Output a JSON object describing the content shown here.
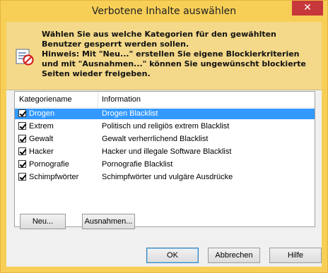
{
  "window": {
    "title": "Verbotene Inhalte auswählen",
    "close_glyph": "✕"
  },
  "banner": {
    "lines": [
      "Wählen Sie aus welche Kategorien für den gewählten Benutzer gesperrt werden sollen.",
      "Hinweis: Mit \"Neu...\" erstellen Sie eigene Blockierkriterien und mit \"Ausnahmen...\" können Sie ungewünscht blockierte Seiten wieder freigeben."
    ],
    "icon": "blocked-list-icon"
  },
  "list": {
    "columns": [
      "Kategoriename",
      "Information"
    ],
    "rows": [
      {
        "name": "Drogen",
        "info": "Drogen Blacklist",
        "checked": true,
        "selected": true
      },
      {
        "name": "Extrem",
        "info": "Politisch und religiös extrem Blacklist",
        "checked": true,
        "selected": false
      },
      {
        "name": "Gewalt",
        "info": "Gewalt verherrlichend Blacklist",
        "checked": true,
        "selected": false
      },
      {
        "name": "Hacker",
        "info": "Hacker und illegale Software Blacklist",
        "checked": true,
        "selected": false
      },
      {
        "name": "Pornografie",
        "info": "Pornografie Blacklist",
        "checked": true,
        "selected": false
      },
      {
        "name": "Schimpfwörter",
        "info": "Schimpfwörter und vulgäre Ausdrücke",
        "checked": true,
        "selected": false
      }
    ]
  },
  "buttons": {
    "new": "Neu...",
    "exceptions": "Ausnahmen...",
    "ok": "OK",
    "cancel": "Abbrechen",
    "help": "Hilfe"
  },
  "colors": {
    "titlebar": "#f7cf57",
    "selection": "#3399ff",
    "close": "#c7383a"
  }
}
